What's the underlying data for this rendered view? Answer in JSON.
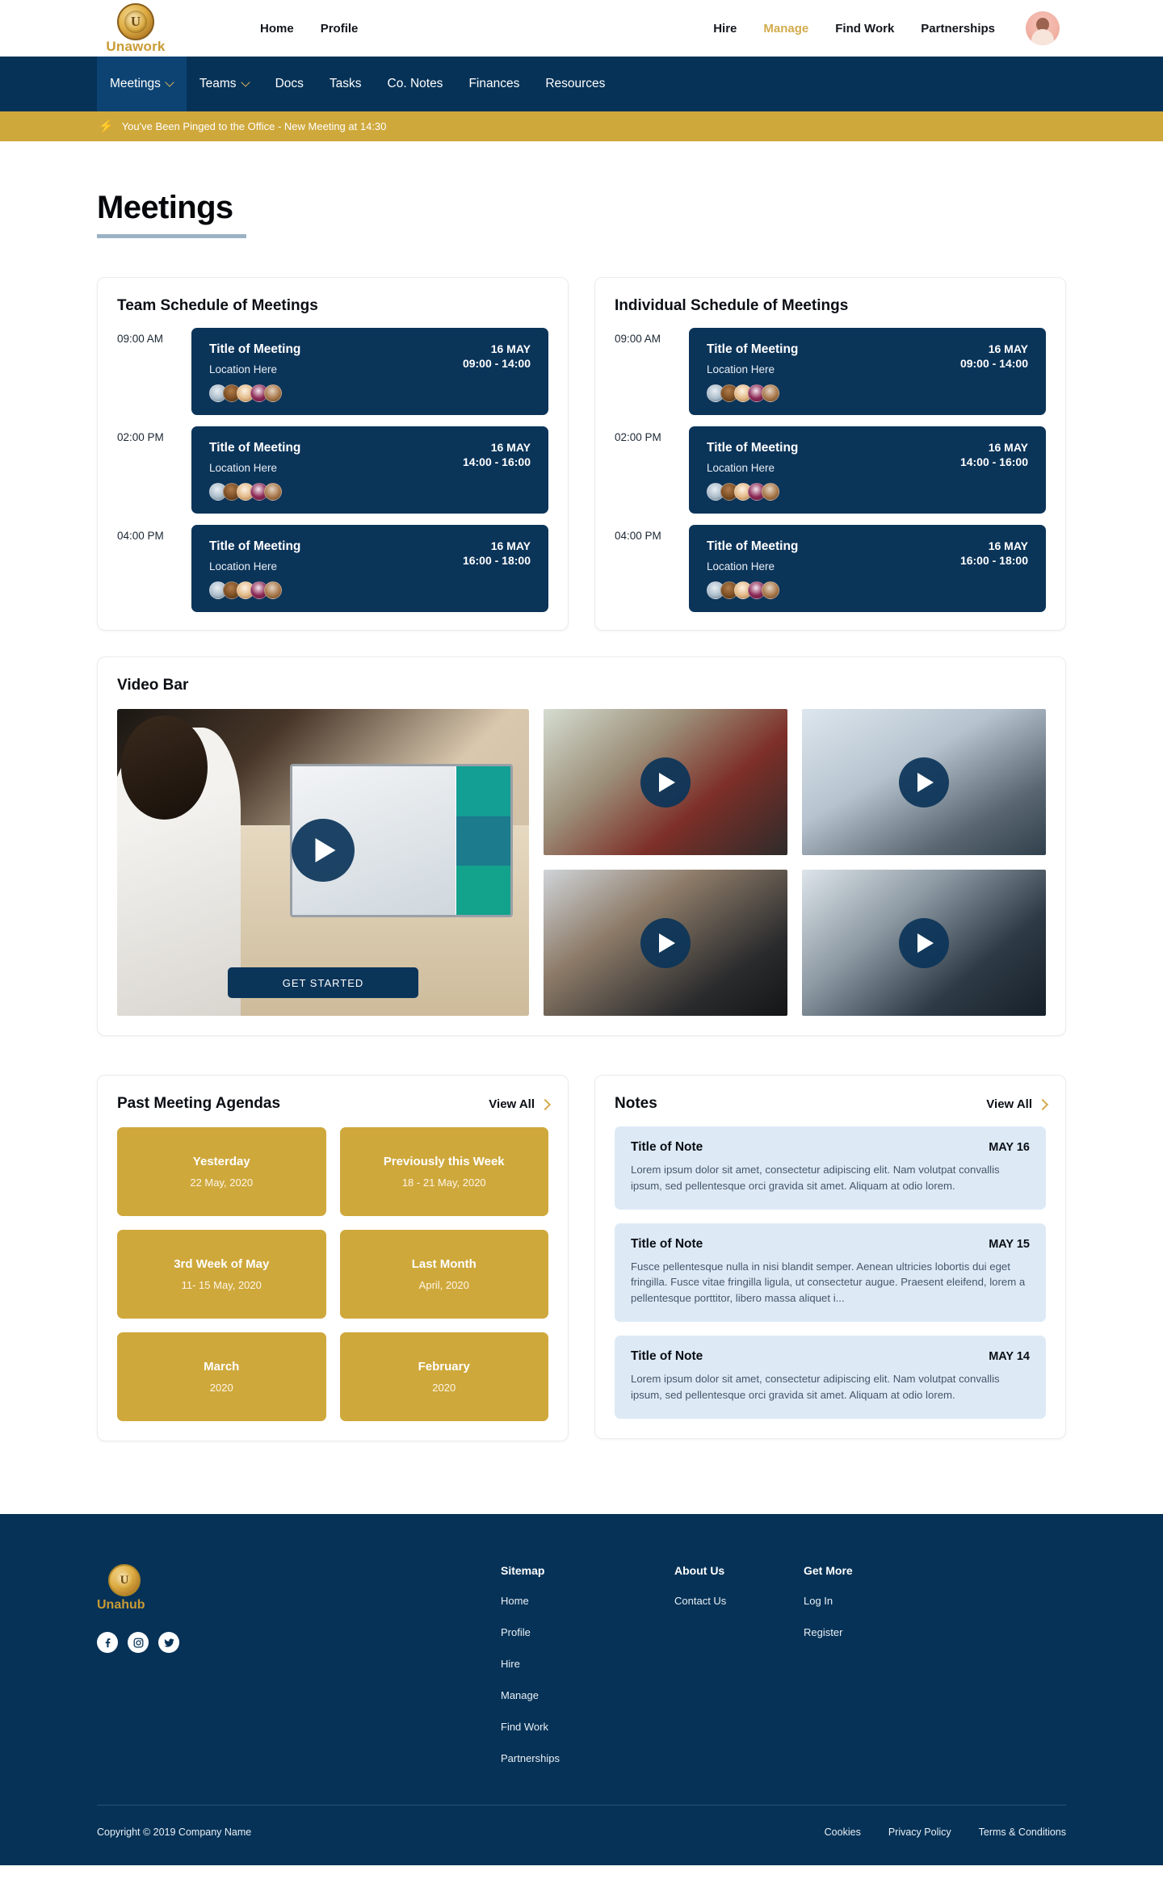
{
  "brand": {
    "name": "Unawork",
    "mark_glyph": "U"
  },
  "topnav": {
    "left": [
      {
        "label": "Home"
      },
      {
        "label": "Profile"
      }
    ],
    "right": [
      {
        "label": "Hire",
        "active": false
      },
      {
        "label": "Manage",
        "active": true
      },
      {
        "label": "Find Work",
        "active": false
      },
      {
        "label": "Partnerships",
        "active": false
      }
    ],
    "avatar_name": "user-avatar"
  },
  "mainnav": {
    "items": [
      {
        "label": "Meetings",
        "caret": true,
        "active": true
      },
      {
        "label": "Teams",
        "caret": true,
        "active": false
      },
      {
        "label": "Docs",
        "caret": false,
        "active": false
      },
      {
        "label": "Tasks",
        "caret": false,
        "active": false
      },
      {
        "label": "Co. Notes",
        "caret": false,
        "active": false
      },
      {
        "label": "Finances",
        "caret": false,
        "active": false
      },
      {
        "label": "Resources",
        "caret": false,
        "active": false
      }
    ]
  },
  "alert": {
    "icon": "lightning-bolt-icon",
    "text": "You've Been Pinged to the Office - New Meeting at 14:30"
  },
  "page": {
    "title": "Meetings"
  },
  "team_schedule": {
    "heading": "Team Schedule of Meetings",
    "rows": [
      {
        "time": "09:00 AM",
        "title": "Title of Meeting",
        "location": "Location Here",
        "date": "16 MAY",
        "range": "09:00 - 14:00"
      },
      {
        "time": "02:00 PM",
        "title": "Title of Meeting",
        "location": "Location Here",
        "date": "16 MAY",
        "range": "14:00 - 16:00"
      },
      {
        "time": "04:00 PM",
        "title": "Title of Meeting",
        "location": "Location Here",
        "date": "16 MAY",
        "range": "16:00 - 18:00"
      }
    ]
  },
  "individual_schedule": {
    "heading": "Individual Schedule of Meetings",
    "rows": [
      {
        "time": "09:00 AM",
        "title": "Title of Meeting",
        "location": "Location Here",
        "date": "16 MAY",
        "range": "09:00 - 14:00"
      },
      {
        "time": "02:00 PM",
        "title": "Title of Meeting",
        "location": "Location Here",
        "date": "16 MAY",
        "range": "14:00 - 16:00"
      },
      {
        "time": "04:00 PM",
        "title": "Title of Meeting",
        "location": "Location Here",
        "date": "16 MAY",
        "range": "16:00 - 18:00"
      }
    ]
  },
  "video_bar": {
    "heading": "Video Bar",
    "cta_label": "GET STARTED",
    "main_video_alt": "man on video call with laptop",
    "thumbs": [
      {
        "alt": "person holding tablet with video call"
      },
      {
        "alt": "two people on couch by window"
      },
      {
        "alt": "woman waving on video call"
      },
      {
        "alt": "person on phone in car"
      }
    ]
  },
  "agendas": {
    "heading": "Past Meeting Agendas",
    "view_all": "View All",
    "tiles": [
      {
        "title": "Yesterday",
        "sub": "22 May, 2020"
      },
      {
        "title": "Previously this Week",
        "sub": "18 - 21 May, 2020"
      },
      {
        "title": "3rd Week of May",
        "sub": "11- 15 May, 2020"
      },
      {
        "title": "Last Month",
        "sub": "April, 2020"
      },
      {
        "title": "March",
        "sub": "2020"
      },
      {
        "title": "February",
        "sub": "2020"
      }
    ]
  },
  "notes": {
    "heading": "Notes",
    "view_all": "View All",
    "items": [
      {
        "title": "Title of Note",
        "date": "MAY 16",
        "body": "Lorem ipsum dolor sit amet, consectetur adipiscing elit. Nam volutpat convallis ipsum, sed pellentesque orci gravida sit amet. Aliquam at odio lorem."
      },
      {
        "title": "Title of Note",
        "date": "MAY 15",
        "body": "Fusce pellentesque nulla in nisi blandit semper. Aenean ultricies lobortis dui eget fringilla. Fusce vitae fringilla ligula, ut consectetur augue. Praesent eleifend, lorem a pellentesque porttitor, libero massa aliquet i..."
      },
      {
        "title": "Title of Note",
        "date": "MAY 14",
        "body": "Lorem ipsum dolor sit amet, consectetur adipiscing elit. Nam volutpat convallis ipsum, sed pellentesque orci gravida sit amet. Aliquam at odio lorem."
      }
    ]
  },
  "footer": {
    "brand_name": "Unahub",
    "brand_mark_glyph": "U",
    "socials": [
      {
        "name": "facebook-icon",
        "glyph": "f"
      },
      {
        "name": "instagram-icon",
        "glyph": "▢"
      },
      {
        "name": "twitter-icon",
        "glyph": "✦"
      }
    ],
    "columns": [
      {
        "heading": "Sitemap",
        "links": [
          "Home",
          "Profile",
          "Hire",
          "Manage",
          "Find Work",
          "Partnerships"
        ]
      },
      {
        "heading": "About Us",
        "links": [
          "Contact Us"
        ]
      },
      {
        "heading": "Get More",
        "links": [
          "Log In",
          "Register"
        ]
      }
    ],
    "copyright": "Copyright © 2019 Company Name",
    "legal": [
      "Cookies",
      "Privacy Policy",
      "Terms & Conditions"
    ]
  },
  "colors": {
    "navy": "#063257",
    "navy_card": "#0b3459",
    "navy_active": "#0c4373",
    "gold": "#cfa83c",
    "gold_text": "#d2ab4d",
    "note_bg": "#ddeaf6",
    "rule": "#9bb2c4"
  }
}
